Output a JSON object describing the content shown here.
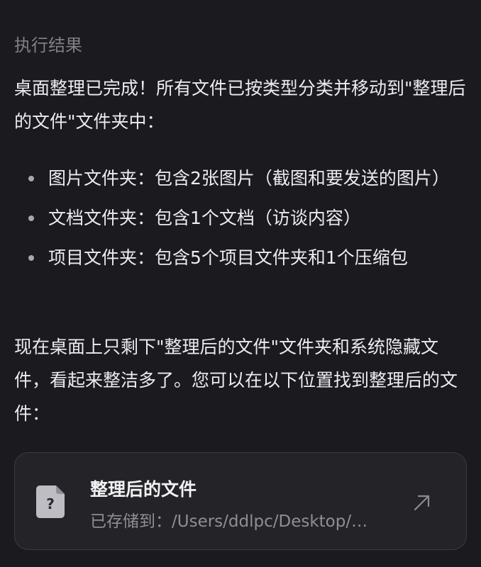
{
  "result": {
    "section_title": "执行结果",
    "intro": "桌面整理已完成！所有文件已按类型分类并移动到\"整理后的文件\"文件夹中：",
    "bullets": [
      "图片文件夹：包含2张图片（截图和要发送的图片）",
      "文档文件夹：包含1个文档（访谈内容）",
      "项目文件夹：包含5个项目文件夹和1个压缩包"
    ],
    "outro": "现在桌面上只剩下\"整理后的文件\"文件夹和系统隐藏文件，看起来整洁多了。您可以在以下位置找到整理后的文件："
  },
  "file_card": {
    "name": "整理后的文件",
    "path_label": "已存储到：",
    "path": "/Users/ddlpc/Desktop/…",
    "file_icon": "unknown-file-icon",
    "open_icon": "arrow-up-right-icon"
  }
}
